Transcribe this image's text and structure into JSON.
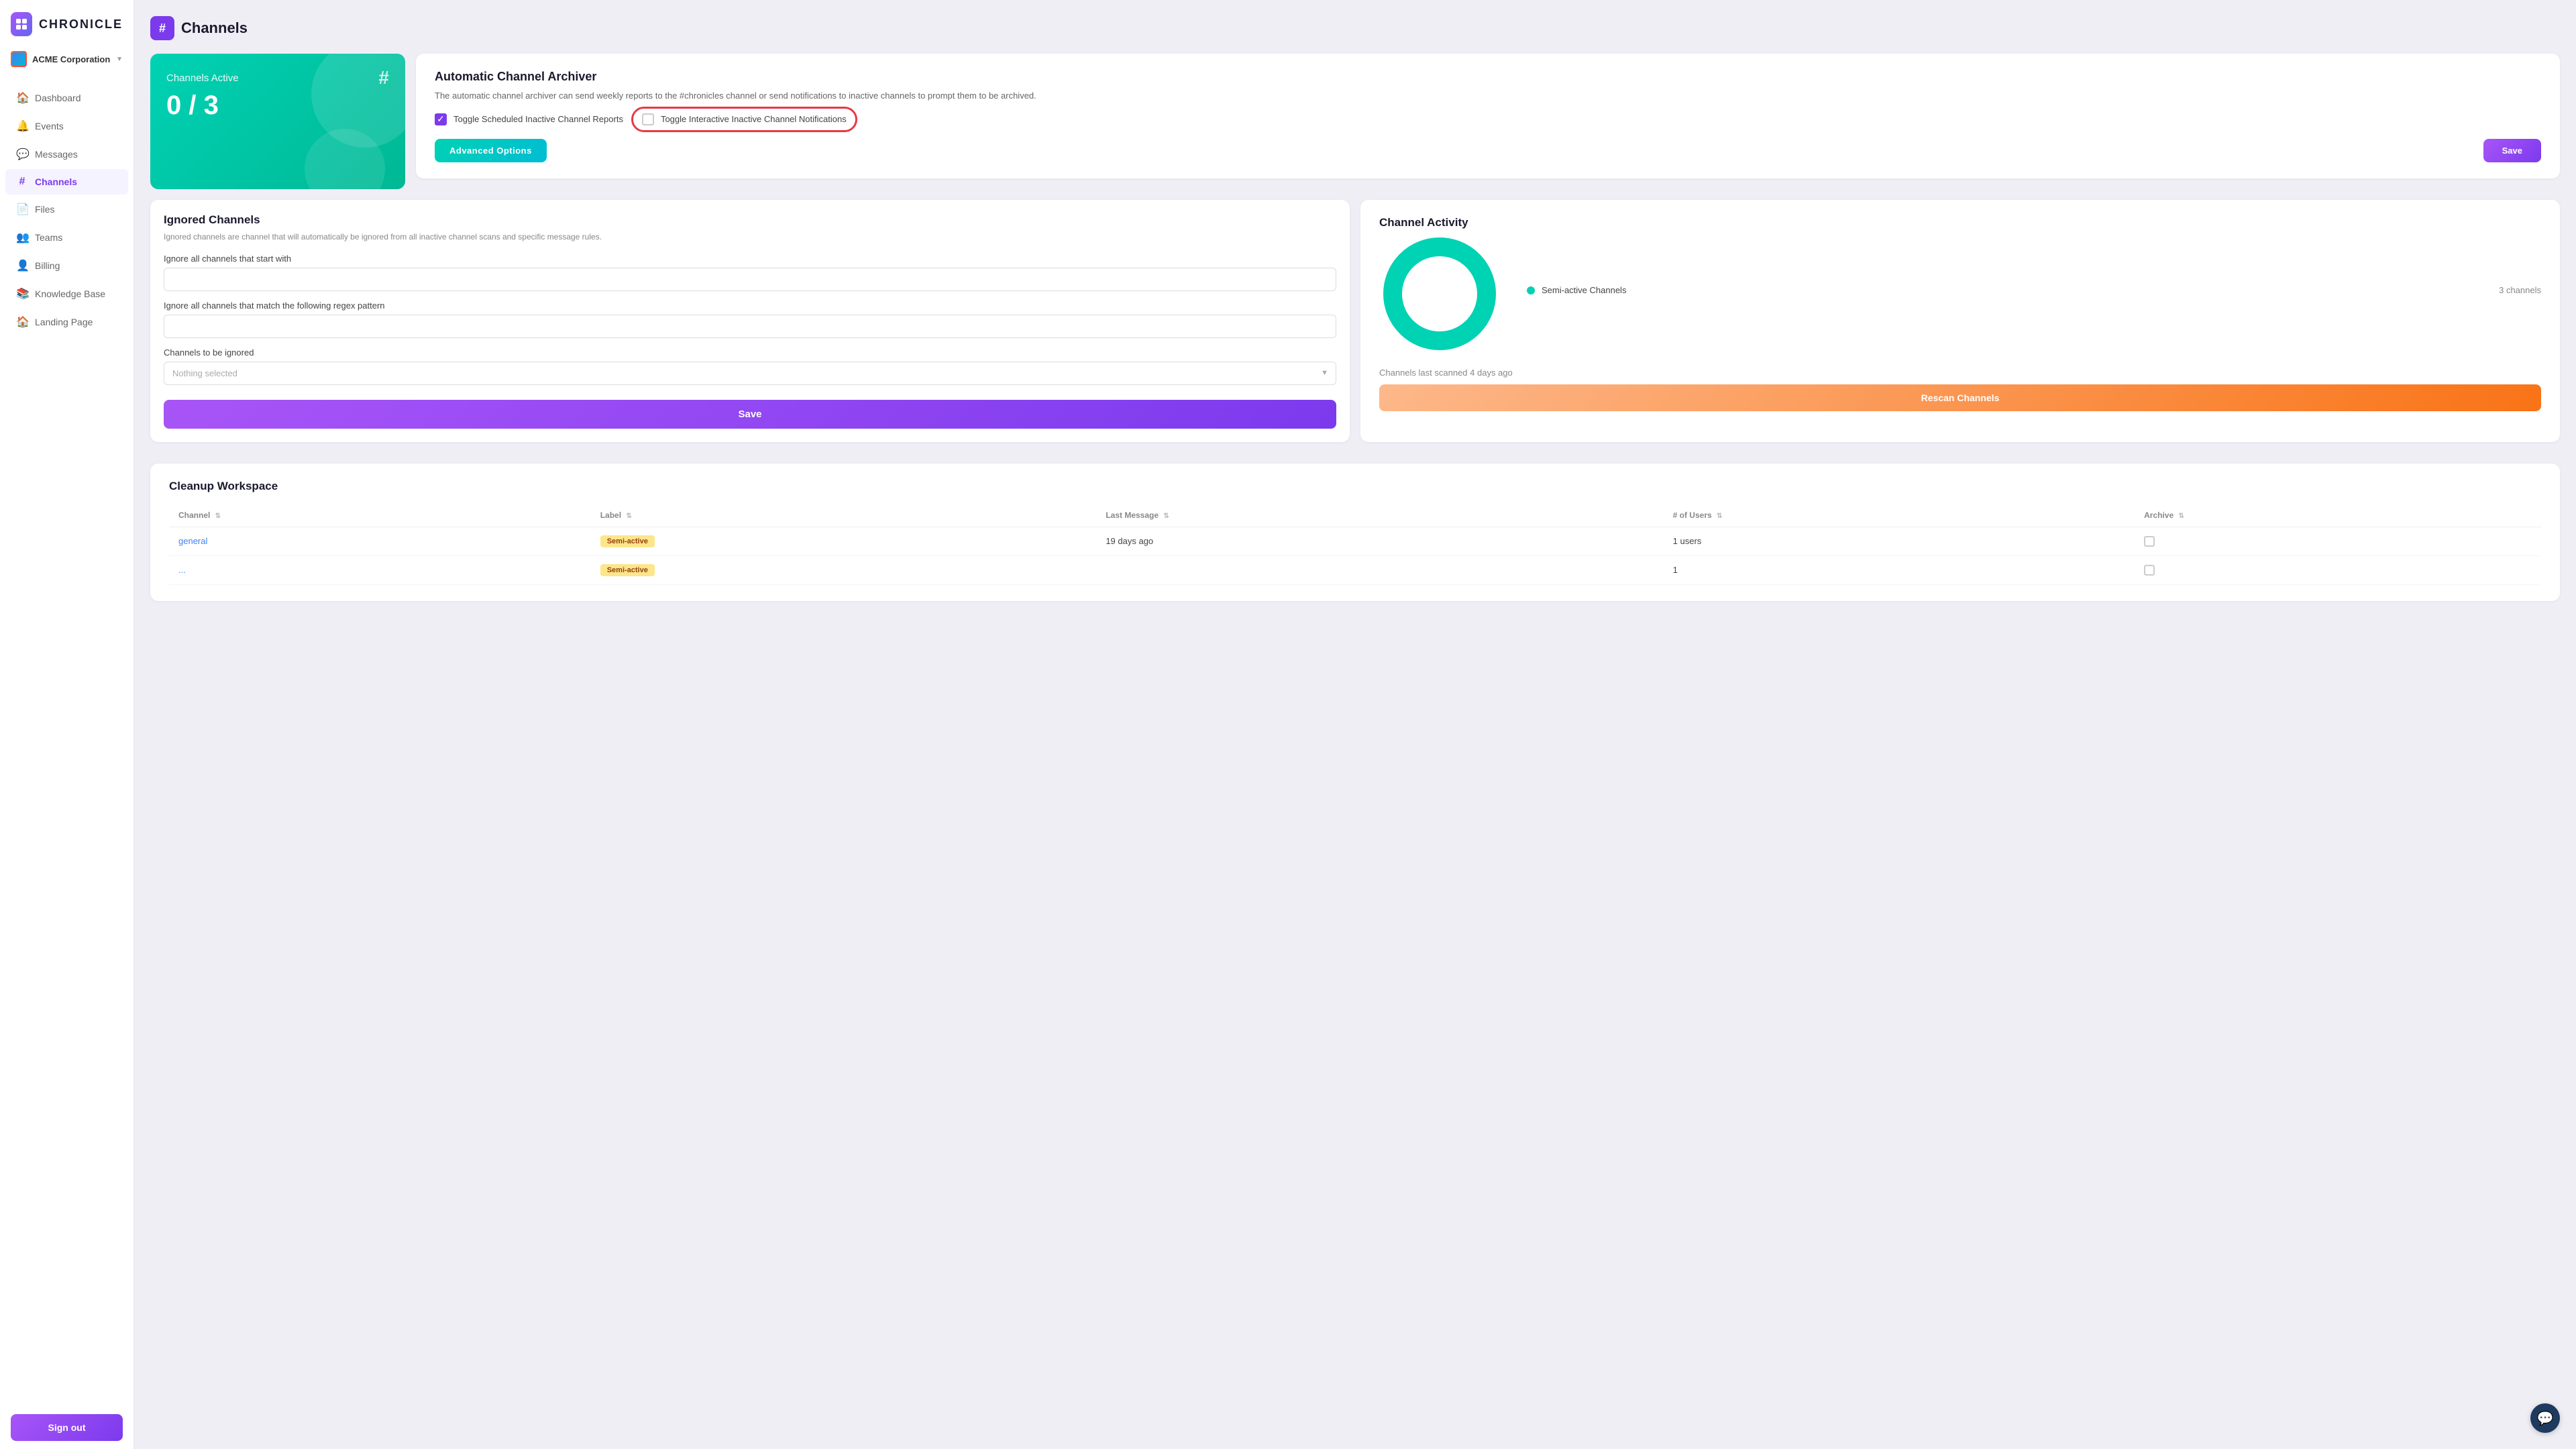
{
  "app": {
    "name": "CHRONICLE",
    "org": "ACME Corporation",
    "page_title": "Channels"
  },
  "sidebar": {
    "nav_items": [
      {
        "id": "dashboard",
        "label": "Dashboard",
        "icon": "🏠",
        "active": false
      },
      {
        "id": "events",
        "label": "Events",
        "icon": "🔔",
        "active": false
      },
      {
        "id": "messages",
        "label": "Messages",
        "icon": "💬",
        "active": false
      },
      {
        "id": "channels",
        "label": "Channels",
        "icon": "#",
        "active": true
      },
      {
        "id": "files",
        "label": "Files",
        "icon": "📄",
        "active": false
      },
      {
        "id": "teams",
        "label": "Teams",
        "icon": "👥",
        "active": false
      },
      {
        "id": "billing",
        "label": "Billing",
        "icon": "👤",
        "active": false
      },
      {
        "id": "knowledge-base",
        "label": "Knowledge Base",
        "icon": "📚",
        "active": false
      },
      {
        "id": "landing-page",
        "label": "Landing Page",
        "icon": "🏠",
        "active": false
      }
    ],
    "sign_out": "Sign out"
  },
  "channels_active": {
    "label": "Channels Active",
    "count": "0 / 3",
    "hash": "#"
  },
  "archiver": {
    "title": "Automatic Channel Archiver",
    "description": "The automatic channel archiver can send weekly reports to the #chronicles channel or send notifications to inactive channels to prompt them to be archived.",
    "toggle_scheduled_label": "Toggle Scheduled Inactive Channel Reports",
    "toggle_interactive_label": "Toggle Interactive Inactive Channel Notifications",
    "toggle_scheduled_checked": true,
    "toggle_interactive_checked": false,
    "advanced_options_label": "Advanced Options",
    "save_label": "Save"
  },
  "ignored_channels": {
    "title": "Ignored Channels",
    "description": "Ignored channels are channel that will automatically be ignored from all inactive channel scans and specific message rules.",
    "field_starts_with_label": "Ignore all channels that start with",
    "field_regex_label": "Ignore all channels that match the following regex pattern",
    "field_channels_label": "Channels to be ignored",
    "select_placeholder": "Nothing selected",
    "save_label": "Save"
  },
  "channel_activity": {
    "title": "Channel Activity",
    "legend": [
      {
        "label": "Semi-active Channels",
        "color": "#00d2b4",
        "count": "3 channels"
      }
    ],
    "scan_info": "Channels last scanned 4 days ago",
    "rescan_label": "Rescan Channels"
  },
  "cleanup_workspace": {
    "title": "Cleanup Workspace",
    "columns": [
      "Channel",
      "Label",
      "Last Message",
      "# of Users",
      "Archive"
    ],
    "rows": [
      {
        "channel": "general",
        "label": "Semi-active",
        "label_type": "semi-active",
        "last_message": "19 days ago",
        "users": "1 users",
        "archive": false
      },
      {
        "channel": "...",
        "label": "Semi-active",
        "label_type": "semi-active",
        "last_message": "...",
        "users": "1",
        "archive": false
      }
    ]
  }
}
